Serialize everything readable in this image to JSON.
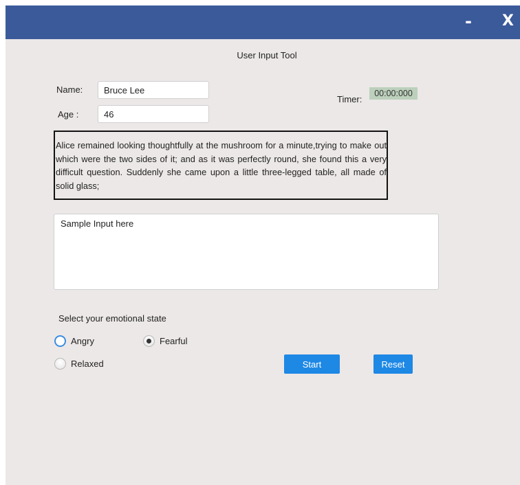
{
  "window": {
    "minimize_label": "-",
    "close_label": "X"
  },
  "app_title": "User Input Tool",
  "form": {
    "name_label": "Name:",
    "name_value": "Bruce Lee",
    "age_label": "Age :",
    "age_value": "46",
    "timer_label": "Timer:",
    "timer_value": "00:00:000"
  },
  "passage": "Alice remained looking thoughtfully at the mushroom for a minute,trying to make out which were the two sides of it; and as it was perfectly round, she found this a very difficult question. Suddenly she came upon a little three-legged table, all made of solid glass;",
  "sample_input": {
    "value": "Sample Input here"
  },
  "emotion": {
    "prompt": "Select your emotional state",
    "options": [
      {
        "label": "Angry",
        "selected": false,
        "focused": true
      },
      {
        "label": "Fearful",
        "selected": true,
        "focused": false
      },
      {
        "label": "Relaxed",
        "selected": false,
        "focused": false
      }
    ]
  },
  "buttons": {
    "start_label": "Start",
    "reset_label": "Reset"
  },
  "colors": {
    "titlebar": "#3b5a9a",
    "background": "#ece8e7",
    "button": "#1e88e5",
    "timer_bg": "#bcd0bc",
    "focus_ring": "#3b8de0"
  }
}
